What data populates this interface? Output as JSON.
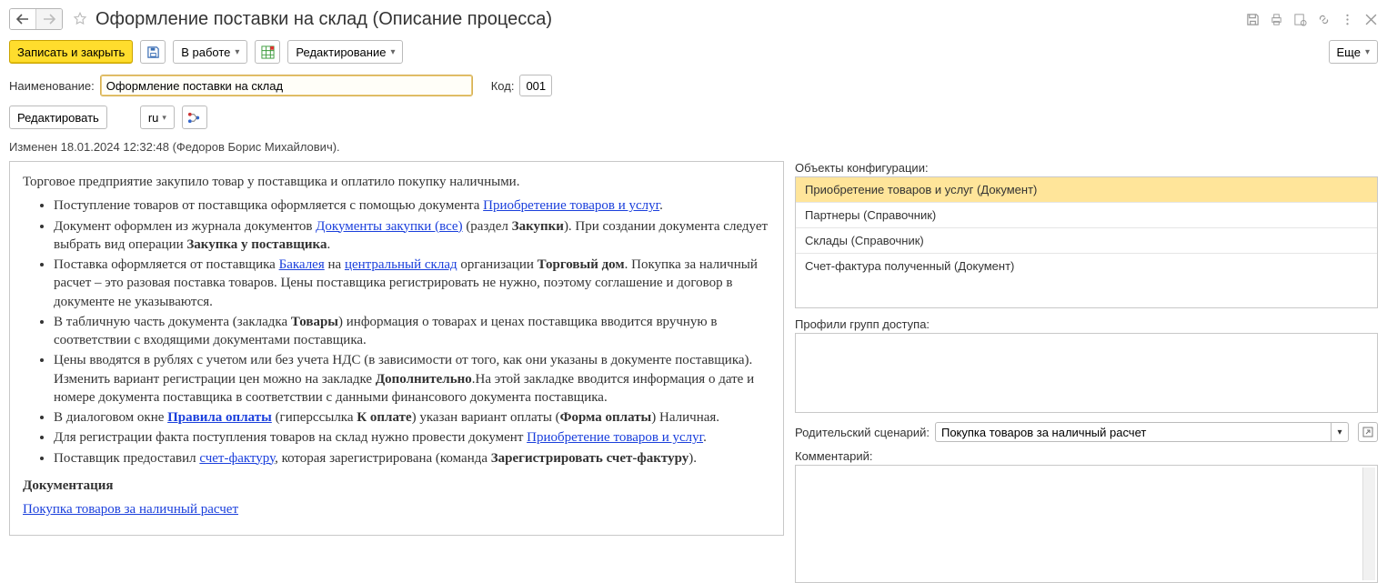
{
  "page": {
    "title": "Оформление поставки на склад (Описание процесса)"
  },
  "cmdbar": {
    "write_close": "Записать и закрыть",
    "in_work": "В работе",
    "editing": "Редактирование",
    "more": "Еще"
  },
  "form": {
    "name_label": "Наименование:",
    "name_value": "Оформление поставки на склад",
    "code_label": "Код:",
    "code_value": "001",
    "edit_btn": "Редактировать",
    "lang": "ru"
  },
  "mod": {
    "text": "Изменен 18.01.2024 12:32:48 (Федоров Борис Михайлович)."
  },
  "desc": {
    "intro": "Торговое предприятие закупило товар у поставщика и оплатило покупку наличными.",
    "li1a": "Поступление товаров от поставщика оформляется с помощью документа ",
    "li1link": "Приобретение товаров и услуг",
    "li1b": ".",
    "li2a": "Документ оформлен из журнала документов ",
    "li2link": "Документы закупки (все)",
    "li2b": " (раздел ",
    "li2bold": "Закупки",
    "li2c": "). При создании документа следует выбрать вид операции ",
    "li2bold2": "Закупка у поставщика",
    "li2d": ".",
    "li3a": "Поставка оформляется от поставщика ",
    "li3link1": "Бакалея",
    "li3b": " на ",
    "li3link2": " центральный склад",
    "li3c": " организации ",
    "li3bold": "Торговый дом",
    "li3d": ". Покупка за наличный расчет – это разовая поставка товаров. Цены поставщика регистрировать не нужно, поэтому соглашение и договор в документе не указываются.",
    "li4a": " В табличную часть документа (закладка ",
    "li4bold": "Товары",
    "li4b": ") информация о товарах и ценах поставщика вводится вручную в соответствии с входящими документами поставщика.",
    "li5a": "Цены вводятся в рублях с учетом или без учета НДС (в зависимости от того, как они указаны в документе поставщика). Изменить вариант регистрации цен можно на закладке ",
    "li5bold": "Дополнительно",
    "li5b": ".На этой закладке вводится информация о дате и номере документа поставщика в соответствии с данными финансового документа поставщика.",
    "li6a": "В диалоговом окне ",
    "li6link": "Правила оплаты",
    "li6b": "  (гиперссылка ",
    "li6bold1": "К оплате",
    "li6c": ") указан вариант оплаты (",
    "li6bold2": "Форма оплаты",
    "li6d": ") Наличная.",
    "li7a": "Для регистрации факта поступления товаров на склад нужно провести документ  ",
    "li7link": "Приобретение товаров и услуг",
    "li7b": ".",
    "li8a": "Поставщик предоставил ",
    "li8link": "счет-фактуру",
    "li8b": ", которая зарегистрирована (команда ",
    "li8bold": "Зарегистрировать счет-фактуру",
    "li8c": ").",
    "doc_head": "Документация",
    "doc_link": "Покупка товаров за наличный расчет"
  },
  "right": {
    "cfg_label": "Объекты конфигурации:",
    "cfg_items": [
      "Приобретение товаров и услуг (Документ)",
      "Партнеры (Справочник)",
      "Склады (Справочник)",
      "Счет-фактура полученный (Документ)"
    ],
    "profiles_label": "Профили групп доступа:",
    "parent_label": "Родительский сценарий:",
    "parent_value": "Покупка товаров за наличный расчет",
    "comment_label": "Комментарий:"
  }
}
